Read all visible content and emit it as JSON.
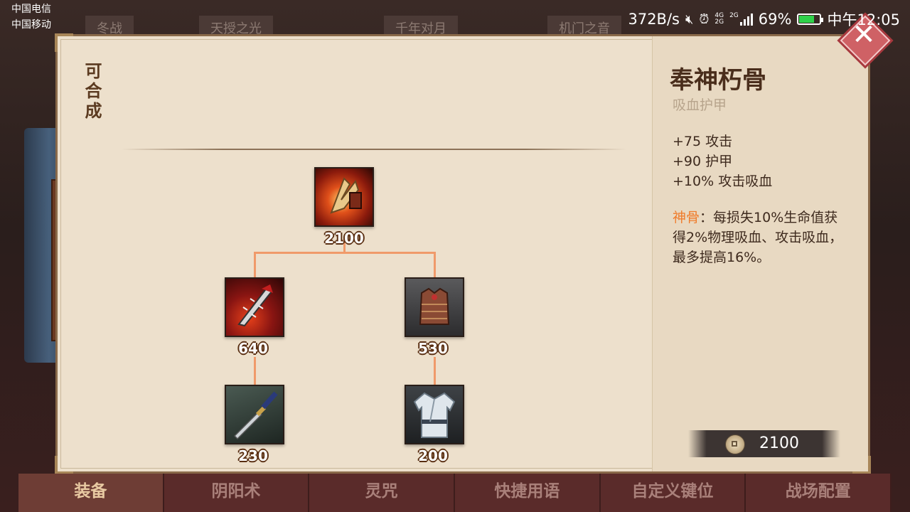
{
  "status_bar": {
    "carrier_1": "中国电信",
    "carrier_2": "中国移动",
    "net_speed": "372B/s",
    "network_1": "4G",
    "network_2": "2G",
    "network_3": "2G",
    "battery": "69%",
    "battery_level": 0.69,
    "time": "中午12:05"
  },
  "background_tabs": [
    "冬战",
    "天授之光",
    "千年对月",
    "机门之音"
  ],
  "panel": {
    "craftable_label": "可合成",
    "tree": {
      "root": {
        "name": "奉神朽骨",
        "price": "2100"
      },
      "components": [
        {
          "price": "640",
          "sub": {
            "price": "230"
          }
        },
        {
          "price": "530",
          "sub": {
            "price": "200"
          }
        }
      ]
    }
  },
  "detail": {
    "name": "奉神朽骨",
    "type": "吸血护甲",
    "stats": [
      "+75 攻击",
      "+90 护甲",
      "+10% 攻击吸血"
    ],
    "passive_name": "神骨",
    "passive_text": "：每损失10%生命值获得2%物理吸血、攻击吸血，最多提高16%。",
    "price": "2100"
  },
  "bottom_tabs": [
    "装备",
    "阴阳术",
    "灵咒",
    "快捷用语",
    "自定义键位",
    "战场配置"
  ],
  "colors": {
    "accent_orange": "#f07a28",
    "tree_line": "#f09a6a",
    "panel_bg": "#ede0cc"
  }
}
